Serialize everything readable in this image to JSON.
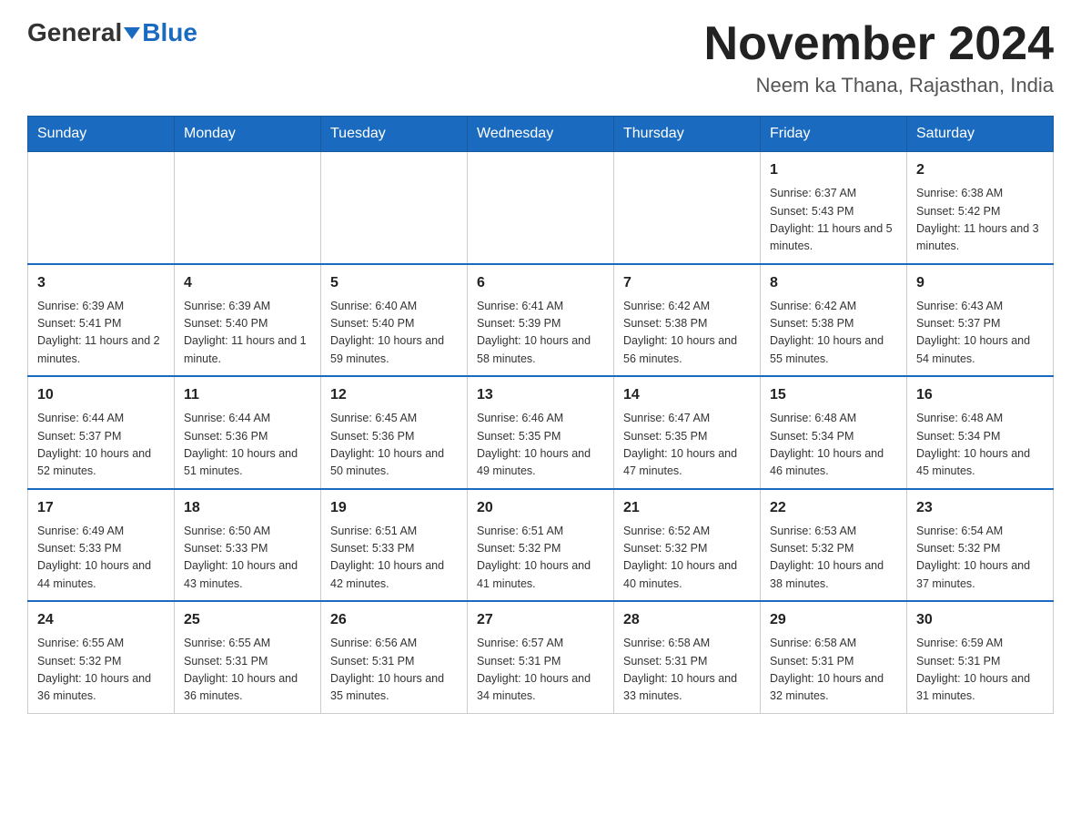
{
  "logo": {
    "general_text": "General",
    "blue_text": "Blue"
  },
  "title": "November 2024",
  "subtitle": "Neem ka Thana, Rajasthan, India",
  "weekdays": [
    "Sunday",
    "Monday",
    "Tuesday",
    "Wednesday",
    "Thursday",
    "Friday",
    "Saturday"
  ],
  "rows": [
    {
      "days": [
        {
          "number": "",
          "info": ""
        },
        {
          "number": "",
          "info": ""
        },
        {
          "number": "",
          "info": ""
        },
        {
          "number": "",
          "info": ""
        },
        {
          "number": "",
          "info": ""
        },
        {
          "number": "1",
          "info": "Sunrise: 6:37 AM\nSunset: 5:43 PM\nDaylight: 11 hours and 5 minutes."
        },
        {
          "number": "2",
          "info": "Sunrise: 6:38 AM\nSunset: 5:42 PM\nDaylight: 11 hours and 3 minutes."
        }
      ]
    },
    {
      "days": [
        {
          "number": "3",
          "info": "Sunrise: 6:39 AM\nSunset: 5:41 PM\nDaylight: 11 hours and 2 minutes."
        },
        {
          "number": "4",
          "info": "Sunrise: 6:39 AM\nSunset: 5:40 PM\nDaylight: 11 hours and 1 minute."
        },
        {
          "number": "5",
          "info": "Sunrise: 6:40 AM\nSunset: 5:40 PM\nDaylight: 10 hours and 59 minutes."
        },
        {
          "number": "6",
          "info": "Sunrise: 6:41 AM\nSunset: 5:39 PM\nDaylight: 10 hours and 58 minutes."
        },
        {
          "number": "7",
          "info": "Sunrise: 6:42 AM\nSunset: 5:38 PM\nDaylight: 10 hours and 56 minutes."
        },
        {
          "number": "8",
          "info": "Sunrise: 6:42 AM\nSunset: 5:38 PM\nDaylight: 10 hours and 55 minutes."
        },
        {
          "number": "9",
          "info": "Sunrise: 6:43 AM\nSunset: 5:37 PM\nDaylight: 10 hours and 54 minutes."
        }
      ]
    },
    {
      "days": [
        {
          "number": "10",
          "info": "Sunrise: 6:44 AM\nSunset: 5:37 PM\nDaylight: 10 hours and 52 minutes."
        },
        {
          "number": "11",
          "info": "Sunrise: 6:44 AM\nSunset: 5:36 PM\nDaylight: 10 hours and 51 minutes."
        },
        {
          "number": "12",
          "info": "Sunrise: 6:45 AM\nSunset: 5:36 PM\nDaylight: 10 hours and 50 minutes."
        },
        {
          "number": "13",
          "info": "Sunrise: 6:46 AM\nSunset: 5:35 PM\nDaylight: 10 hours and 49 minutes."
        },
        {
          "number": "14",
          "info": "Sunrise: 6:47 AM\nSunset: 5:35 PM\nDaylight: 10 hours and 47 minutes."
        },
        {
          "number": "15",
          "info": "Sunrise: 6:48 AM\nSunset: 5:34 PM\nDaylight: 10 hours and 46 minutes."
        },
        {
          "number": "16",
          "info": "Sunrise: 6:48 AM\nSunset: 5:34 PM\nDaylight: 10 hours and 45 minutes."
        }
      ]
    },
    {
      "days": [
        {
          "number": "17",
          "info": "Sunrise: 6:49 AM\nSunset: 5:33 PM\nDaylight: 10 hours and 44 minutes."
        },
        {
          "number": "18",
          "info": "Sunrise: 6:50 AM\nSunset: 5:33 PM\nDaylight: 10 hours and 43 minutes."
        },
        {
          "number": "19",
          "info": "Sunrise: 6:51 AM\nSunset: 5:33 PM\nDaylight: 10 hours and 42 minutes."
        },
        {
          "number": "20",
          "info": "Sunrise: 6:51 AM\nSunset: 5:32 PM\nDaylight: 10 hours and 41 minutes."
        },
        {
          "number": "21",
          "info": "Sunrise: 6:52 AM\nSunset: 5:32 PM\nDaylight: 10 hours and 40 minutes."
        },
        {
          "number": "22",
          "info": "Sunrise: 6:53 AM\nSunset: 5:32 PM\nDaylight: 10 hours and 38 minutes."
        },
        {
          "number": "23",
          "info": "Sunrise: 6:54 AM\nSunset: 5:32 PM\nDaylight: 10 hours and 37 minutes."
        }
      ]
    },
    {
      "days": [
        {
          "number": "24",
          "info": "Sunrise: 6:55 AM\nSunset: 5:32 PM\nDaylight: 10 hours and 36 minutes."
        },
        {
          "number": "25",
          "info": "Sunrise: 6:55 AM\nSunset: 5:31 PM\nDaylight: 10 hours and 36 minutes."
        },
        {
          "number": "26",
          "info": "Sunrise: 6:56 AM\nSunset: 5:31 PM\nDaylight: 10 hours and 35 minutes."
        },
        {
          "number": "27",
          "info": "Sunrise: 6:57 AM\nSunset: 5:31 PM\nDaylight: 10 hours and 34 minutes."
        },
        {
          "number": "28",
          "info": "Sunrise: 6:58 AM\nSunset: 5:31 PM\nDaylight: 10 hours and 33 minutes."
        },
        {
          "number": "29",
          "info": "Sunrise: 6:58 AM\nSunset: 5:31 PM\nDaylight: 10 hours and 32 minutes."
        },
        {
          "number": "30",
          "info": "Sunrise: 6:59 AM\nSunset: 5:31 PM\nDaylight: 10 hours and 31 minutes."
        }
      ]
    }
  ]
}
